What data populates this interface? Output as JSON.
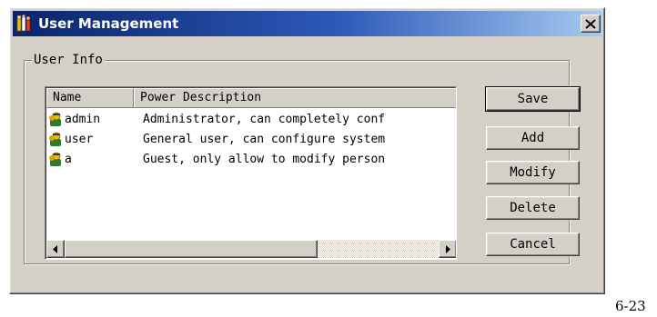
{
  "window": {
    "title": "User Management",
    "close_label": "×",
    "titlebar_colors": [
      "#0a246a",
      "#a6caf0"
    ]
  },
  "group": {
    "label": "User Info"
  },
  "table": {
    "columns": [
      "Name",
      "Power Description"
    ],
    "rows": [
      {
        "name": "admin",
        "power": "Administrator, can completely conf",
        "icon": "user-icon"
      },
      {
        "name": "user",
        "power": "General user, can configure system",
        "icon": "user-icon"
      },
      {
        "name": "a",
        "power": "Guest, only allow to modify person",
        "icon": "user-icon"
      }
    ],
    "scrollbar": {
      "left_arrow": "left-arrow-icon",
      "right_arrow": "right-arrow-icon",
      "position": 0
    }
  },
  "buttons": {
    "save": "Save",
    "add": "Add",
    "modify": "Modify",
    "delete": "Delete",
    "cancel": "Cancel"
  },
  "caption": "6-23"
}
